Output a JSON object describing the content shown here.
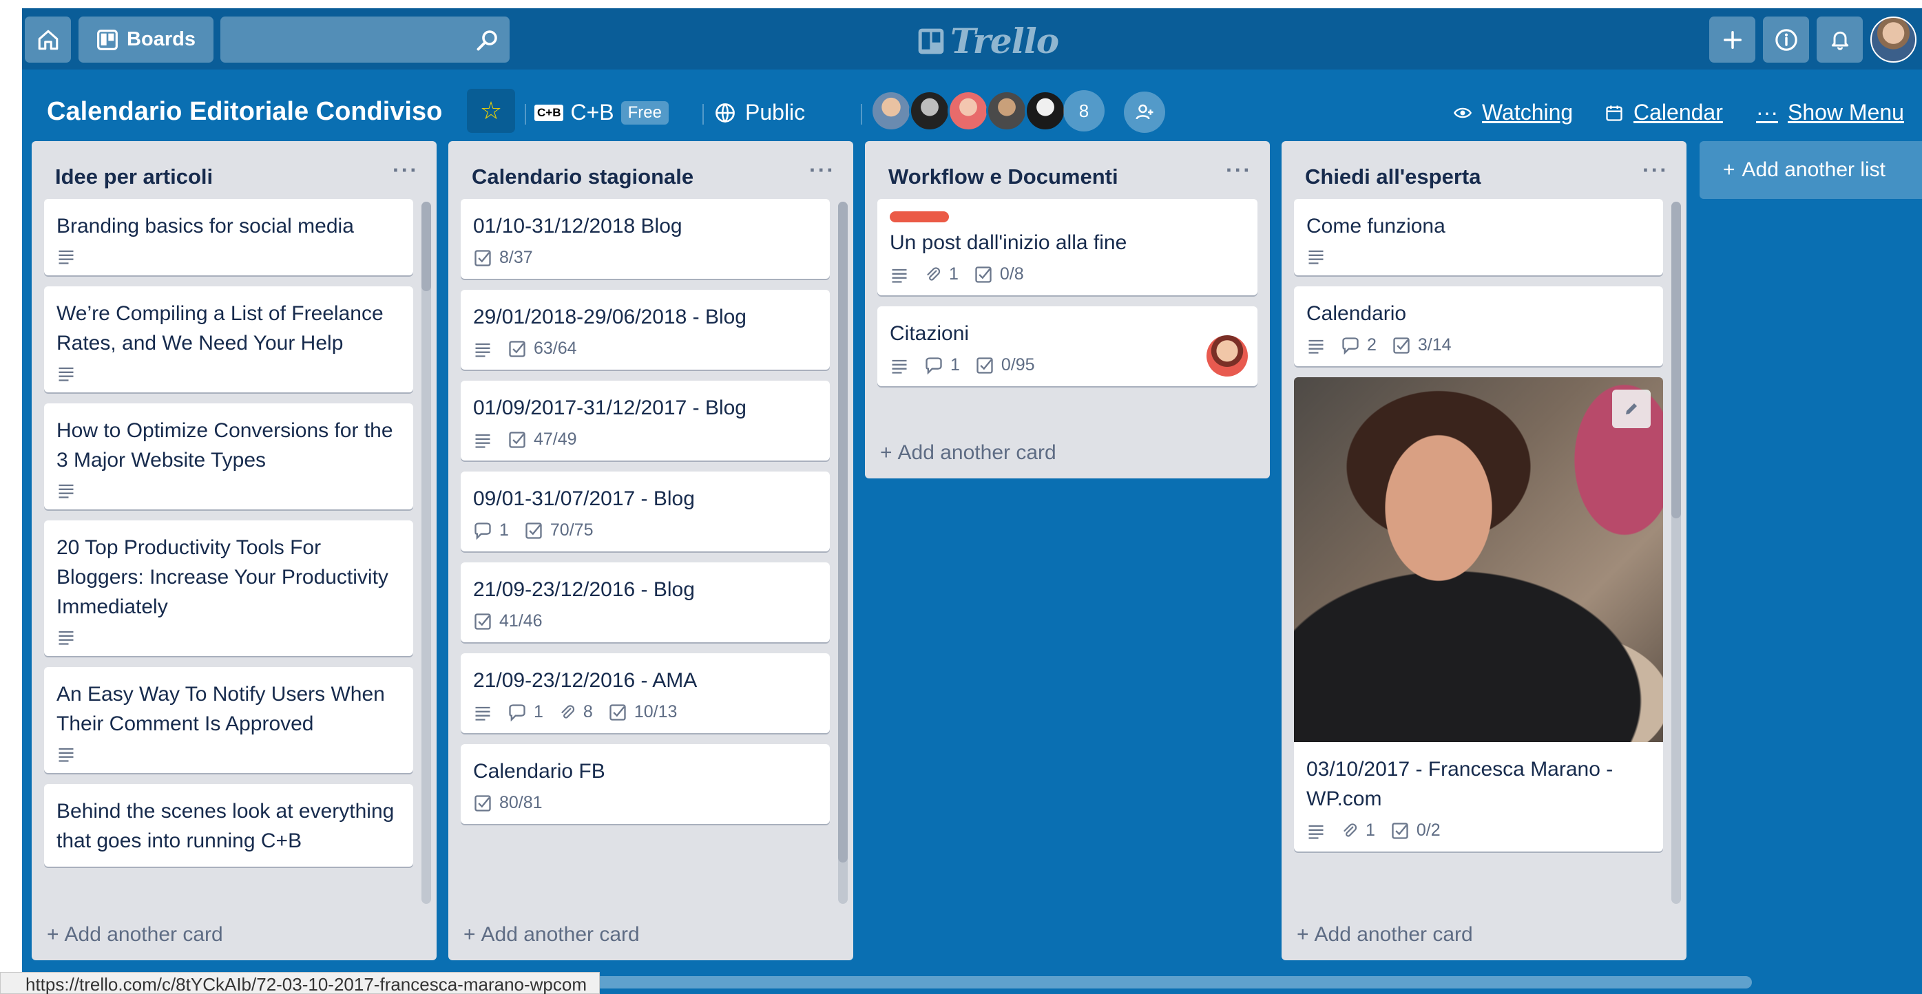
{
  "header": {
    "boards_label": "Boards",
    "search_placeholder": "",
    "logo_text": "Trello"
  },
  "board": {
    "title": "Calendario Editoriale Condiviso",
    "team_logo": "C+B",
    "team_name": "C+B",
    "plan_badge": "Free",
    "visibility": "Public",
    "member_count": "8",
    "watching_label": "Watching",
    "calendar_label": "Calendar",
    "show_menu_label": "Show Menu"
  },
  "lists": [
    {
      "title": "Idee per articoli",
      "add_card": "Add another card",
      "cards": [
        {
          "title": "Branding basics for social media",
          "desc": true
        },
        {
          "title": "We’re Compiling a List of Freelance Rates, and We Need Your Help",
          "desc": true
        },
        {
          "title": "How to Optimize Conversions for the 3 Major Website Types",
          "desc": true
        },
        {
          "title": "20 Top Productivity Tools For Bloggers: Increase Your Productivity Immediately",
          "desc": true
        },
        {
          "title": "An Easy Way To Notify Users When Their Comment Is Approved",
          "desc": true
        },
        {
          "title": "Behind the scenes look at everything that goes into running C+B",
          "desc": false
        }
      ]
    },
    {
      "title": "Calendario stagionale",
      "add_card": "Add another card",
      "cards": [
        {
          "title": "01/10-31/12/2018 Blog",
          "checklist": "8/37"
        },
        {
          "title": "29/01/2018-29/06/2018 - Blog",
          "desc": true,
          "checklist": "63/64"
        },
        {
          "title": "01/09/2017-31/12/2017 - Blog",
          "desc": true,
          "checklist": "47/49"
        },
        {
          "title": "09/01-31/07/2017 - Blog",
          "comments": "1",
          "checklist": "70/75"
        },
        {
          "title": "21/09-23/12/2016 - Blog",
          "checklist": "41/46"
        },
        {
          "title": "21/09-23/12/2016 - AMA",
          "desc": true,
          "comments": "1",
          "attachments": "8",
          "checklist": "10/13"
        },
        {
          "title": "Calendario FB",
          "checklist": "80/81"
        }
      ]
    },
    {
      "title": "Workflow e Documenti",
      "add_card": "Add another card",
      "cards": [
        {
          "title": "Un post dall'inizio alla fine",
          "label_color": "#eb5a46",
          "desc": true,
          "attachments": "1",
          "checklist": "0/8"
        },
        {
          "title": "Citazioni",
          "desc": true,
          "comments": "1",
          "checklist": "0/95",
          "member": true
        }
      ]
    },
    {
      "title": "Chiedi all'esperta",
      "add_card": "Add another card",
      "cards": [
        {
          "title": "Come funziona",
          "desc": true
        },
        {
          "title": "Calendario",
          "desc": true,
          "comments": "2",
          "checklist": "3/14"
        },
        {
          "title": "03/10/2017 - Francesca Marano - WP.com",
          "cover": true,
          "desc": true,
          "attachments": "1",
          "checklist": "0/2"
        }
      ]
    }
  ],
  "add_list_label": "Add another list",
  "status_url": "https://trello.com/c/8tYCkAIb/72-03-10-2017-francesca-marano-wpcom",
  "colors": {
    "board_bg": "#0a6fb2",
    "header_bg": "#0a5d98",
    "list_bg": "#dfe1e6",
    "label_red": "#eb5a46",
    "star": "#f2d600"
  }
}
